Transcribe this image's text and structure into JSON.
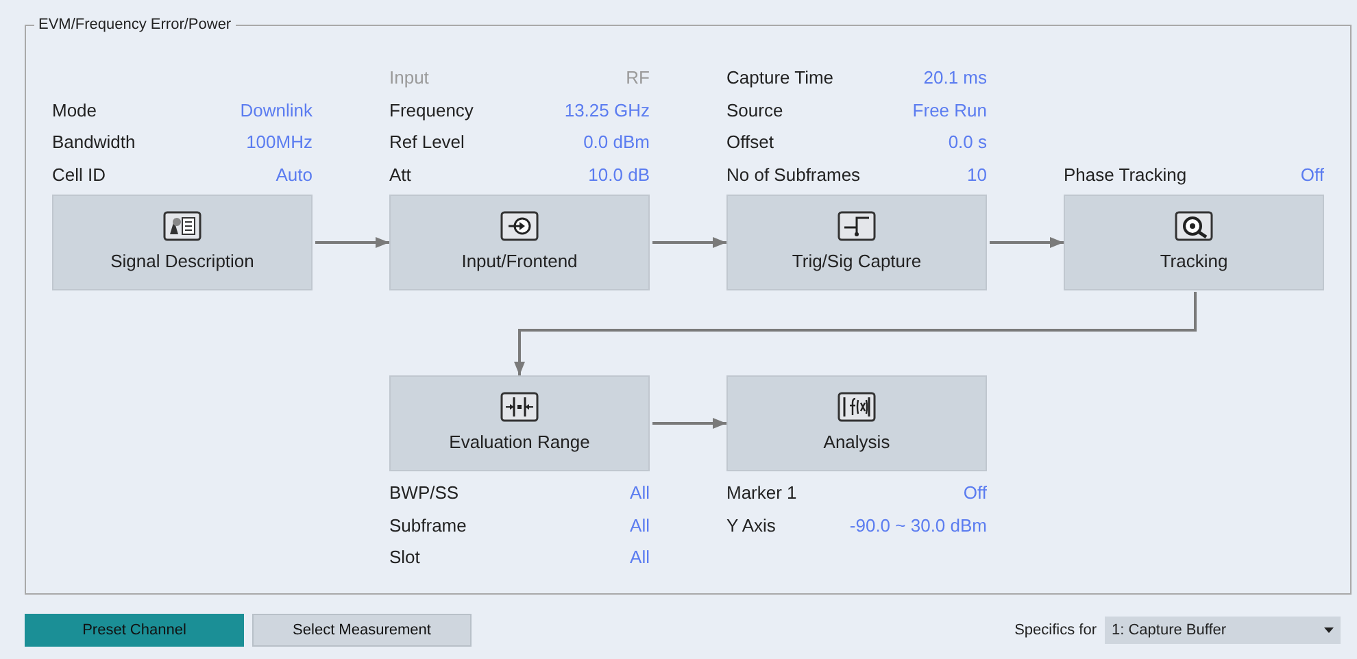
{
  "panel": {
    "title": "EVM/Frequency Error/Power"
  },
  "rows": [
    [
      {
        "label": "Signal Description",
        "params": [
          {
            "label": "Mode",
            "value": "Downlink",
            "disabled": false
          },
          {
            "label": "Bandwidth",
            "value": "100MHz",
            "disabled": false
          },
          {
            "label": "Cell ID",
            "value": "Auto",
            "disabled": false
          }
        ]
      },
      {
        "label": "Input/Frontend",
        "params": [
          {
            "label": "Input",
            "value": "RF",
            "disabled": true
          },
          {
            "label": "Frequency",
            "value": "13.25 GHz",
            "disabled": false
          },
          {
            "label": "Ref Level",
            "value": "0.0 dBm",
            "disabled": false
          },
          {
            "label": "Att",
            "value": "10.0 dB",
            "disabled": false
          }
        ]
      },
      {
        "label": "Trig/Sig Capture",
        "params": [
          {
            "label": "Capture Time",
            "value": "20.1 ms",
            "disabled": false
          },
          {
            "label": "Source",
            "value": "Free Run",
            "disabled": false
          },
          {
            "label": "Offset",
            "value": "0.0 s",
            "disabled": false
          },
          {
            "label": "No of Subframes",
            "value": "10",
            "disabled": false
          }
        ]
      },
      {
        "label": "Tracking",
        "params": [
          {
            "label": "Phase Tracking",
            "value": "Off",
            "disabled": false
          }
        ]
      }
    ],
    [
      {
        "label": "Evaluation Range",
        "params": [
          {
            "label": "BWP/SS",
            "value": "All",
            "disabled": false
          },
          {
            "label": "Subframe",
            "value": "All",
            "disabled": false
          },
          {
            "label": "Slot",
            "value": "All",
            "disabled": false
          }
        ]
      },
      {
        "label": "Analysis",
        "params": [
          {
            "label": "Marker 1",
            "value": "Off",
            "disabled": false
          },
          {
            "label": "Y Axis",
            "value": "-90.0 ~ 30.0 dBm",
            "disabled": false
          }
        ]
      }
    ]
  ],
  "footer": {
    "buttons": [
      {
        "label": "Preset Channel",
        "kind": "primary"
      },
      {
        "label": "Select Measurement",
        "kind": "secondary"
      }
    ],
    "specifics": {
      "label": "Specifics for",
      "value": "1: Capture Buffer"
    }
  }
}
